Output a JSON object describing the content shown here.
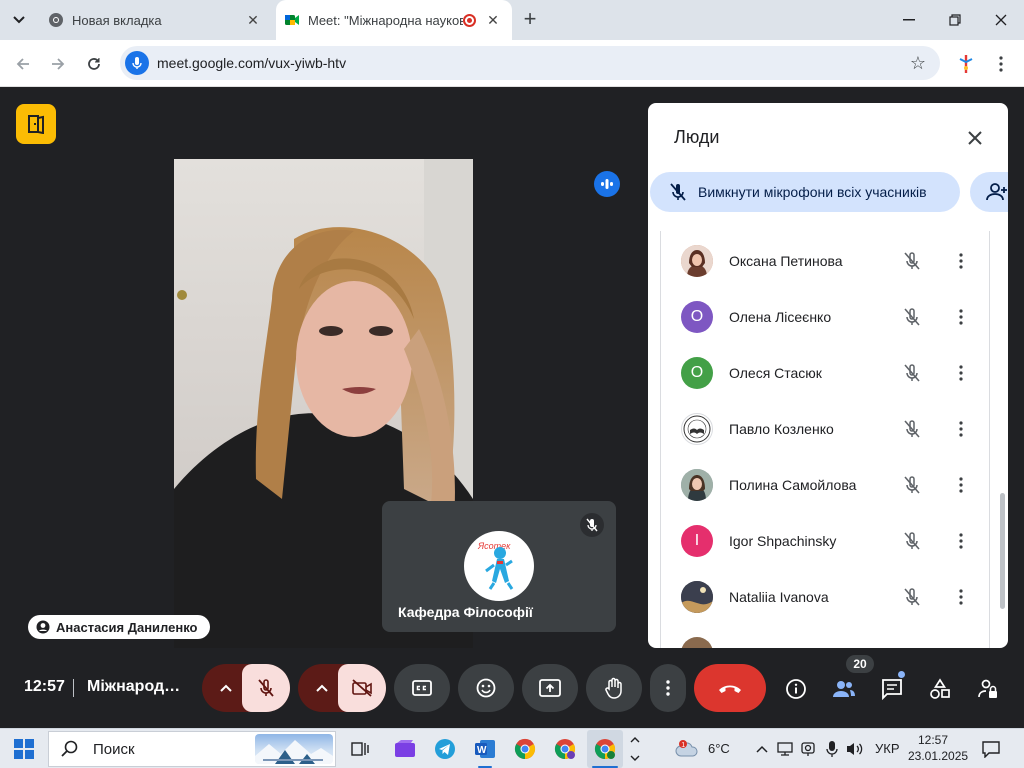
{
  "browser": {
    "tabs": [
      {
        "title": "Новая вкладка",
        "active": false
      },
      {
        "title": "Meet: \"Міжнародна науков",
        "active": true
      }
    ],
    "url": "meet.google.com/vux-yiwb-htv"
  },
  "meet": {
    "speaker_name": "Анастасия Даниленко",
    "self_tile_name": "Кафедра Філософії",
    "time": "12:57",
    "meeting_title": "Міжнарод…",
    "participant_count": "20"
  },
  "people_panel": {
    "title": "Люди",
    "mute_all_label": "Вимкнути мікрофони всіх учасників",
    "participants": [
      {
        "name": "Оксана Петинова",
        "avatar_type": "photo",
        "initial": "",
        "color": "#c98a6b"
      },
      {
        "name": "Олена Лісеєнко",
        "avatar_type": "initial",
        "initial": "О",
        "color": "#7e57c2"
      },
      {
        "name": "Олеся Стасюк",
        "avatar_type": "initial",
        "initial": "О",
        "color": "#43a047"
      },
      {
        "name": "Павло Козленко",
        "avatar_type": "logo",
        "initial": "",
        "color": "#ffffff"
      },
      {
        "name": "Полина Самойлова",
        "avatar_type": "photo",
        "initial": "",
        "color": "#8d9aa3"
      },
      {
        "name": "Igor Shpachinsky",
        "avatar_type": "initial",
        "initial": "I",
        "color": "#e52f6d"
      },
      {
        "name": "Nataliia Ivanova",
        "avatar_type": "photo",
        "initial": "",
        "color": "#4a4a55"
      }
    ]
  },
  "taskbar": {
    "search_label": "Поиск",
    "weather_temp": "6°C",
    "language": "УКР",
    "clock_time": "12:57",
    "clock_date": "23.01.2025"
  },
  "colors": {
    "end_call": "#dc362e",
    "muted_control": "#f9dedc",
    "accent": "#1a73e8",
    "brand_yellow": "#fbbc04"
  }
}
